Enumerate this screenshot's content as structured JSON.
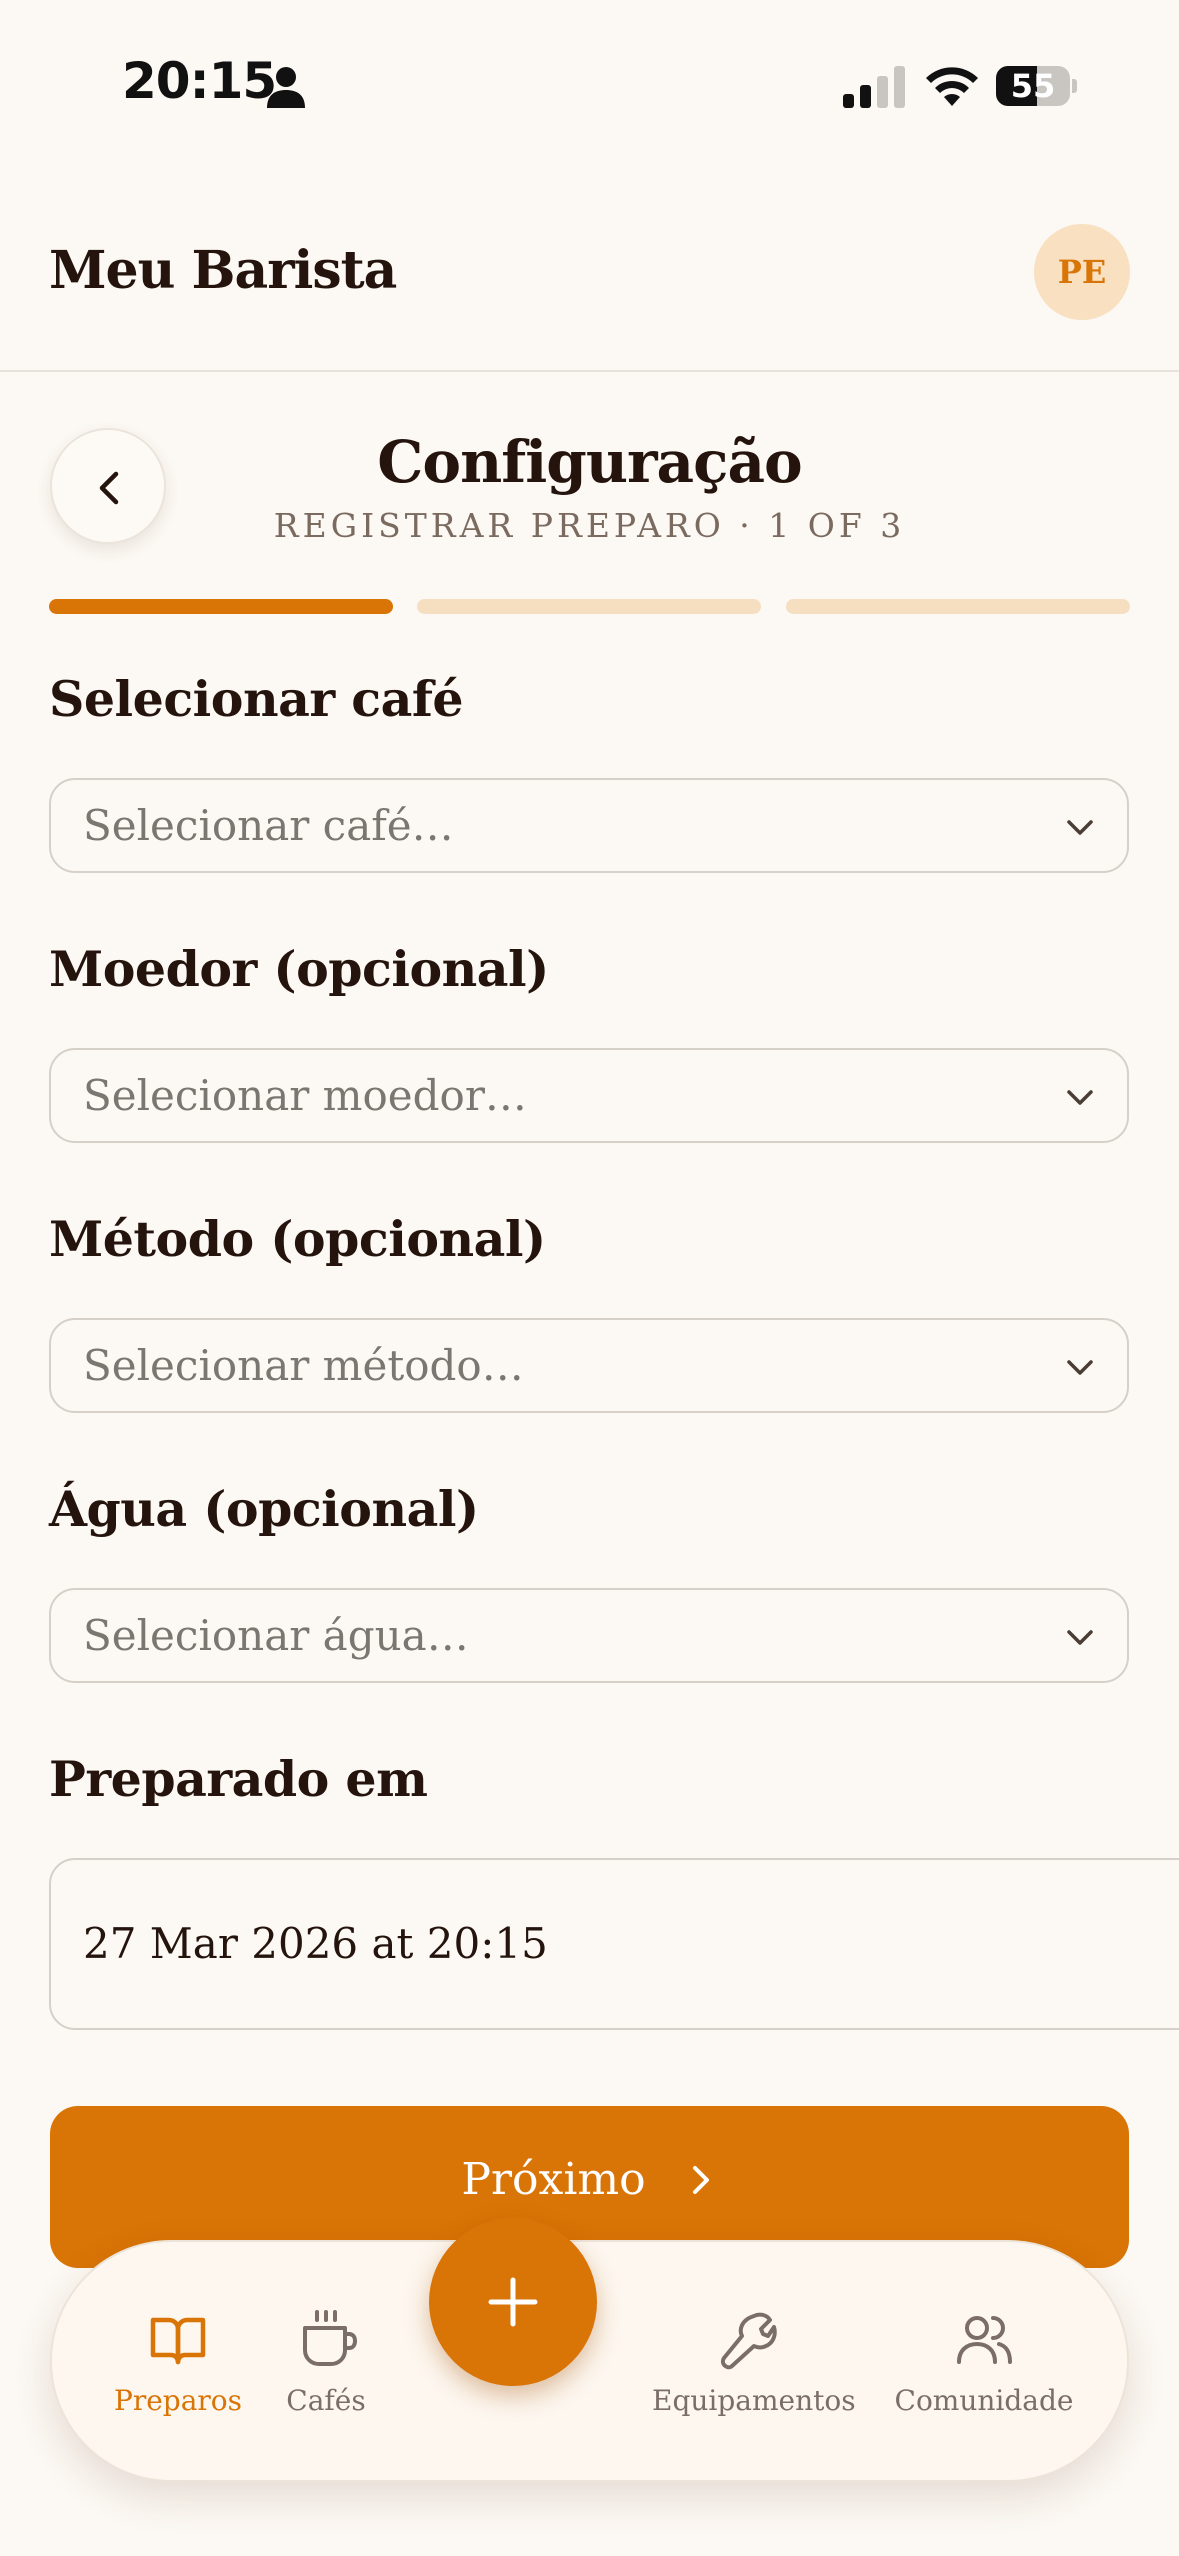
{
  "status_bar": {
    "time": "20:15",
    "battery": "55",
    "battery_level": 0.55,
    "icons": [
      "person-icon",
      "signal-icon",
      "wifi-icon",
      "battery-icon"
    ]
  },
  "header": {
    "title": "Meu Barista",
    "avatar_initials": "PE"
  },
  "step": {
    "title": "Configuração",
    "subtitle": "REGISTRAR PREPARO · 1 OF 3",
    "current": 1,
    "total": 3
  },
  "form": {
    "coffee": {
      "label": "Selecionar café",
      "placeholder": "Selecionar café…"
    },
    "grinder": {
      "label": "Moedor (opcional)",
      "placeholder": "Selecionar moedor…"
    },
    "method": {
      "label": "Método (opcional)",
      "placeholder": "Selecionar método…"
    },
    "water": {
      "label": "Água (opcional)",
      "placeholder": "Selecionar água…"
    },
    "brewed_at": {
      "label": "Preparado em",
      "value": "27 Mar 2026 at 20:15"
    }
  },
  "next_button": {
    "label": "Próximo"
  },
  "tabbar": {
    "items": [
      {
        "label": "Preparos",
        "icon": "book-icon",
        "active": true
      },
      {
        "label": "Cafés",
        "icon": "coffee-cup-icon",
        "active": false
      },
      {
        "label": "Equipamentos",
        "icon": "wrench-icon",
        "active": false
      },
      {
        "label": "Comunidade",
        "icon": "users-icon",
        "active": false
      }
    ],
    "fab_icon": "plus-icon"
  },
  "colors": {
    "accent": "#d97406",
    "background": "#fcf8f3",
    "text": "#24140d",
    "muted": "#7c7670",
    "progress_inactive": "#f5dfc0",
    "avatar_bg": "#f8e0c0"
  }
}
